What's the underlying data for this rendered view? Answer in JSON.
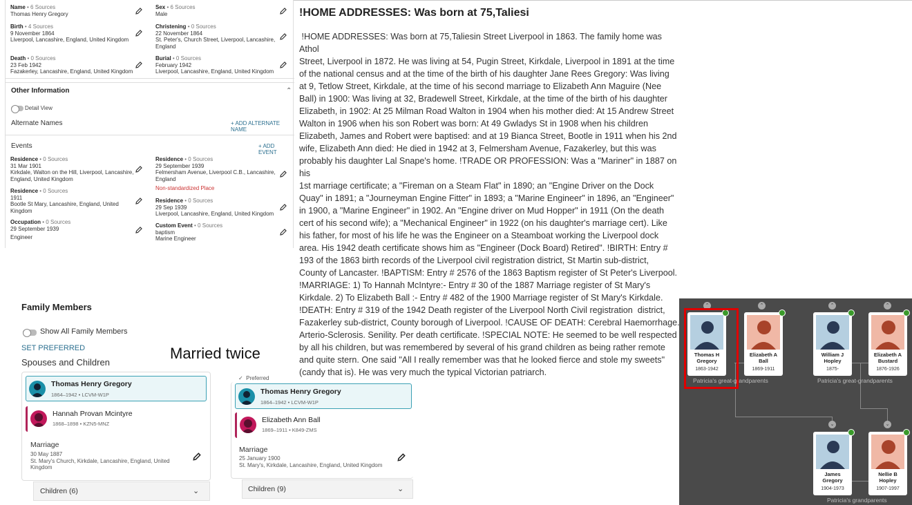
{
  "vitals": {
    "name": {
      "label": "Name",
      "sources": "• 6 Sources",
      "value": "Thomas Henry Gregory"
    },
    "sex": {
      "label": "Sex",
      "sources": "• 6 Sources",
      "value": "Male"
    },
    "birth": {
      "label": "Birth",
      "sources": "• 4 Sources",
      "date": "9 November 1864",
      "place": "Liverpool, Lancashire, England, United Kingdom"
    },
    "christening": {
      "label": "Christening",
      "sources": "• 0 Sources",
      "date": "22 November 1864",
      "place": "St. Peter's, Church Street, Liverpool, Lancashire,",
      "place2": "England"
    },
    "death": {
      "label": "Death",
      "sources": "• 0 Sources",
      "date": "23 Feb 1942",
      "place": "Fazakerley, Lancashire, England, United Kingdom"
    },
    "burial": {
      "label": "Burial",
      "sources": "• 0 Sources",
      "date": "February 1942",
      "place": "Liverpool, Lancashire, England, United Kingdom"
    }
  },
  "other": {
    "heading": "Other Information",
    "detail_view": "Detail View",
    "alternate_names": "Alternate Names",
    "add_alternate_name": "+  ADD ALTERNATE NAME",
    "events": "Events",
    "add_event": "+  ADD EVENT"
  },
  "events": {
    "e1": {
      "label": "Residence",
      "sources": "• 0 Sources",
      "date": "31 Mar 1901",
      "place": "Kirkdale, Walton on the Hill, Liverpool, Lancashire,",
      "place2": "England, United Kingdom"
    },
    "e2": {
      "label": "Residence",
      "sources": "• 0 Sources",
      "date": "29 September 1939",
      "place": "Felmersham Avenue, Liverpool C.B., Lancashire,",
      "place2": "England",
      "warning": "Non-standardized Place"
    },
    "e3": {
      "label": "Residence",
      "sources": "• 0 Sources",
      "date": "1911",
      "place": "Bootle St Mary, Lancashire, England, United",
      "place2": "Kingdom"
    },
    "e4": {
      "label": "Residence",
      "sources": "• 0 Sources",
      "date": "29 Sep 1939",
      "place": "Liverpool, Lancashire, England, United Kingdom"
    },
    "e5": {
      "label": "Occupation",
      "sources": "• 0 Sources",
      "date": "29 September 1939",
      "place": "Engineer"
    },
    "e6": {
      "label": "Custom Event",
      "sources": "• 0 Sources",
      "date": "baptism",
      "place": "Marine Engineer"
    }
  },
  "notes": {
    "title": "!HOME ADDRESSES: Was born at 75,Taliesi",
    "body": " !HOME ADDRESSES: Was born at 75,Taliesin Street Liverpool in 1863. The family home was Athol\nStreet, Liverpool in 1872. He was living at 54, Pugin Street, Kirkdale, Liverpool in 1891 at the time\nof the national census and at the time of the birth of his daughter Jane Rees Gregory: Was living\nat 9, Tetlow Street, Kirkdale, at the time of his second marriage to Elizabeth Ann Maguire (Nee\nBall) in 1900: Was living at 32, Bradewell Street, Kirkdale, at the time of the birth of his daughter\nElizabeth, in 1902: At 25 Milman Road Walton in 1904 when his mother died: At 15 Andrew Street\nWalton in 1906 when his son Robert was born: At 49 Gwladys St in 1908 when his children\nElizabeth, James and Robert were baptised: and at 19 Bianca Street, Bootle in 1911 when his 2nd\nwife, Elizabeth Ann died: He died in 1942 at 3, Felmersham Avenue, Fazakerley, but this was\nprobably his daughter Lal Snape's home. !TRADE OR PROFESSION: Was a \"Mariner\" in 1887 on his\n1st marriage certificate; a \"Fireman on a Steam Flat\" in 1890; an \"Engine Driver on the Dock\nQuay\" in 1891; a \"Journeyman Engine Fitter\" in 1893; a \"Marine Engineer\" in 1896, an \"Engineer\"\nin 1900, a \"Marine Engineer\" in 1902. An \"Engine driver on Mud Hopper\" in 1911 (On the death\ncert of his second wife); a \"Mechanical Engineer\" in 1922 (on his daughter's marriage cert). Like\nhis father, for most of his life he was the Engineer on a Steamboat working the Liverpool dock\narea. His 1942 death certificate shows him as \"Engineer (Dock Board) Retired\". !BIRTH: Entry #\n193 of the 1863 birth records of the Liverpool civil registration district, St Martin sub-district,\nCounty of Lancaster. !BAPTISM: Entry # 2576 of the 1863 Baptism register of St Peter's Liverpool.\n!MARRIAGE: 1) To Hannah McIntyre:- Entry # 30 of the 1887 Marriage register of St Mary's\nKirkdale. 2) To Elizabeth Ball :- Entry # 482 of the 1900 Marriage register of St Mary's Kirkdale.\n!DEATH: Entry # 319 of the 1942 Death register of the Liverpool North Civil registration  district,\nFazakerley sub-district, County borough of Liverpool. !CAUSE OF DEATH: Cerebral Haemorrhage.\nArterio-Sclerosis. Senility. Per death certificate. !SPECIAL NOTE: He seemed to be well respected\nby all his children, but was remembered by several of his grand children as being rather remote\nand quite stern. One said \"All I really remember was that he looked fierce and stole my sweets\"\n(candy that is). He was very much the typical Victorian patriarch."
  },
  "family": {
    "title": "Family Members",
    "show_all": "Show All Family Members",
    "set_preferred": "SET PREFERRED",
    "spouses_heading": "Spouses and Children",
    "annotation": "Married twice",
    "card1": {
      "husband": {
        "name": "Thomas Henry Gregory",
        "meta": "1864–1942  •  LCVM-W1P"
      },
      "wife": {
        "name": "Hannah Provan Mcintyre",
        "meta": "1868–1898  •  KZN5-MNZ"
      },
      "marriage_label": "Marriage",
      "marriage_date": "30 May 1887",
      "marriage_place": "St. Mary's Church, Kirkdale, Lancashire, England, United",
      "marriage_place2": "Kingdom",
      "children": "Children (6)"
    },
    "card2": {
      "preferred": "Preferred",
      "husband": {
        "name": "Thomas Henry Gregory",
        "meta": "1864–1942  •  LCVM-W1P"
      },
      "wife": {
        "name": "Elizabeth Ann Ball",
        "meta": "1869–1911  •  K849-ZMS"
      },
      "marriage_label": "Marriage",
      "marriage_date": "25 January 1900",
      "marriage_place": "St. Mary's, Kirkdale, Lancashire, England, United Kingdom",
      "children": "Children (9)"
    }
  },
  "tree": {
    "p1": {
      "name": "Thomas H",
      "name2": "Gregory",
      "dates": "1863-1942"
    },
    "p2": {
      "name": "Elizabeth A",
      "name2": "Ball",
      "dates": "1869-1911"
    },
    "p3": {
      "name": "William J",
      "name2": "Hopley",
      "dates": "1875-"
    },
    "p4": {
      "name": "Elizabeth A",
      "name2": "Bustard",
      "dates": "1876-1926"
    },
    "p5": {
      "name": "James",
      "name2": "Gregory",
      "dates": "1904-1973"
    },
    "p6": {
      "name": "Nellie B",
      "name2": "Hopley",
      "dates": "1907-1997"
    },
    "cap1": "Patricia's great-grandparents",
    "cap2": "Patricia's great-grandparents",
    "cap3": "Patricia's grandparents"
  },
  "colors": {
    "accent": "#2b6f8f",
    "female": "#b0245a",
    "highlight": "#e00000",
    "tree_bg": "#4a4a4a"
  }
}
